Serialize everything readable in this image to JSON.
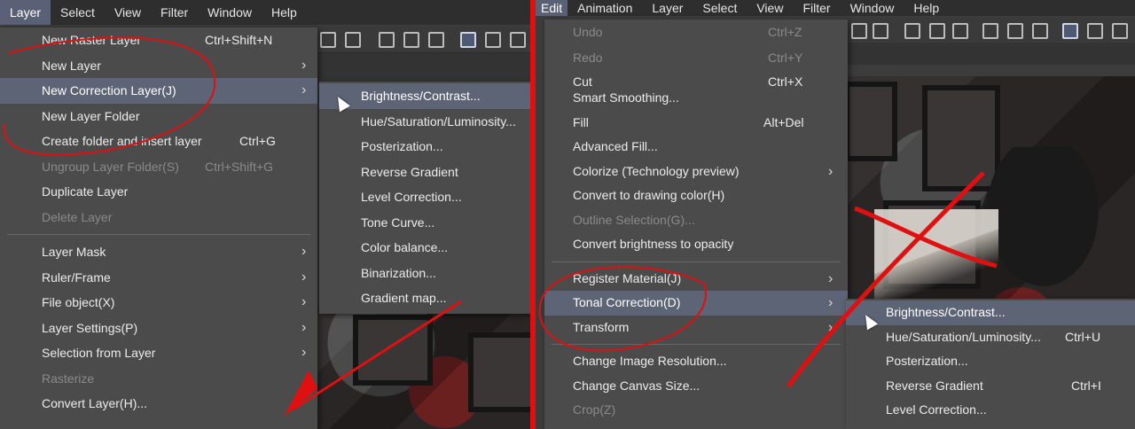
{
  "left": {
    "menubar": [
      "Layer",
      "Select",
      "View",
      "Filter",
      "Window",
      "Help"
    ],
    "layer_menu": [
      {
        "label": "New Raster Layer",
        "shortcut": "Ctrl+Shift+N"
      },
      {
        "label": "New Layer",
        "arrow": "›"
      },
      {
        "label": "New Correction Layer(J)",
        "arrow": "›"
      },
      {
        "label": "New Layer Folder"
      },
      {
        "label": "Create folder and insert layer",
        "shortcut": "Ctrl+G"
      },
      {
        "label": "Ungroup Layer Folder(S)",
        "shortcut": "Ctrl+Shift+G"
      },
      {
        "label": "Duplicate Layer"
      },
      {
        "label": "Delete Layer"
      },
      {
        "label": "Layer Mask",
        "arrow": "›"
      },
      {
        "label": "Ruler/Frame",
        "arrow": "›"
      },
      {
        "label": "File object(X)",
        "arrow": "›"
      },
      {
        "label": "Layer Settings(P)",
        "arrow": "›"
      },
      {
        "label": "Selection from Layer",
        "arrow": "›"
      },
      {
        "label": "Rasterize"
      },
      {
        "label": "Convert Layer(H)..."
      }
    ],
    "correction_submenu": [
      "Brightness/Contrast...",
      "Hue/Saturation/Luminosity...",
      "Posterization...",
      "Reverse Gradient",
      "Level Correction...",
      "Tone Curve...",
      "Color balance...",
      "Binarization...",
      "Gradient map..."
    ]
  },
  "right": {
    "menubar": [
      "Edit",
      "Animation",
      "Layer",
      "Select",
      "View",
      "Filter",
      "Window",
      "Help"
    ],
    "edit_menu": [
      {
        "label": "Undo",
        "shortcut": "Ctrl+Z"
      },
      {
        "label": "Redo",
        "shortcut": "Ctrl+Y"
      },
      {
        "label": "Cut",
        "shortcut": "Ctrl+X"
      },
      {
        "label": "Smart Smoothing..."
      },
      {
        "label": "Fill",
        "shortcut": "Alt+Del"
      },
      {
        "label": "Advanced Fill..."
      },
      {
        "label": "Colorize (Technology preview)",
        "arrow": "›"
      },
      {
        "label": "Convert to drawing color(H)"
      },
      {
        "label": "Outline Selection(G)..."
      },
      {
        "label": "Convert brightness to opacity"
      },
      {
        "label": "Register Material(J)",
        "arrow": "›"
      },
      {
        "label": "Tonal Correction(D)",
        "arrow": "›"
      },
      {
        "label": "Transform",
        "arrow": "›"
      },
      {
        "label": "Change Image Resolution..."
      },
      {
        "label": "Change Canvas Size..."
      },
      {
        "label": "Crop(Z)"
      }
    ],
    "tonal_submenu": [
      {
        "label": "Brightness/Contrast..."
      },
      {
        "label": "Hue/Saturation/Luminosity...",
        "shortcut": "Ctrl+U"
      },
      {
        "label": "Posterization..."
      },
      {
        "label": "Reverse Gradient",
        "shortcut": "Ctrl+I"
      },
      {
        "label": "Level Correction..."
      }
    ]
  },
  "colors": {
    "annotation_red": "#e01010",
    "menu_bg": "#4b4b4b",
    "highlight": "#5c6475",
    "menubar_active": "#5a6176"
  }
}
